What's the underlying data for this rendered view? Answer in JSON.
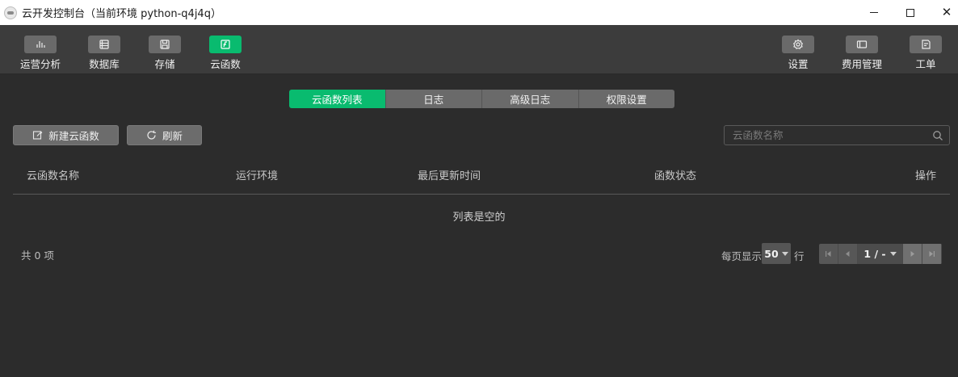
{
  "window": {
    "title": "云开发控制台（当前环境 python-q4j4q）",
    "close_glyph": "✕"
  },
  "toolbar": {
    "left": [
      {
        "label": "运营分析",
        "icon": "bar-chart-icon"
      },
      {
        "label": "数据库",
        "icon": "database-icon"
      },
      {
        "label": "存储",
        "icon": "storage-icon"
      },
      {
        "label": "云函数",
        "icon": "cloud-function-icon",
        "active": true
      }
    ],
    "right": [
      {
        "label": "设置",
        "icon": "gear-icon"
      },
      {
        "label": "费用管理",
        "icon": "billing-icon"
      },
      {
        "label": "工单",
        "icon": "ticket-icon"
      }
    ]
  },
  "tabs": [
    {
      "label": "云函数列表",
      "active": true
    },
    {
      "label": "日志"
    },
    {
      "label": "高级日志"
    },
    {
      "label": "权限设置"
    }
  ],
  "actions": {
    "new_label": "新建云函数",
    "refresh_label": "刷新"
  },
  "search": {
    "placeholder": "云函数名称"
  },
  "table": {
    "columns": [
      "云函数名称",
      "运行环境",
      "最后更新时间",
      "函数状态",
      "操作"
    ],
    "rows": [],
    "empty_text": "列表是空的"
  },
  "footer": {
    "total": "共 0 项",
    "per_page_label": "每页显示",
    "per_page_value": "50",
    "row_unit": "行",
    "page_text": "1 / -"
  },
  "colors": {
    "accent": "#09bb6f",
    "background": "#2c2c2c",
    "toolbar": "#3c3c3c"
  }
}
